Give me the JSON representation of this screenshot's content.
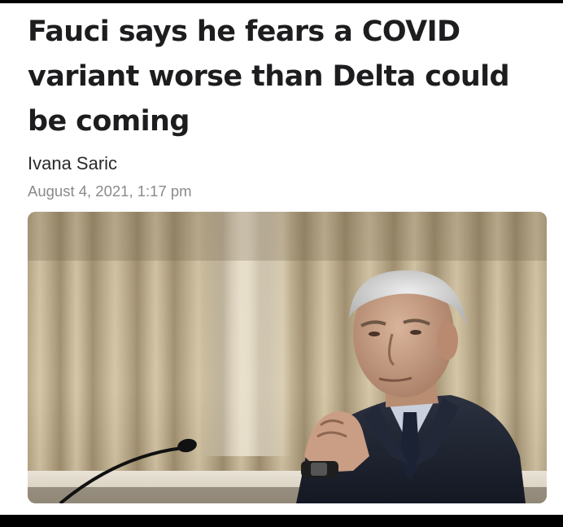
{
  "article": {
    "headline": "Fauci says he fears a COVID variant worse than Delta could be coming",
    "author": "Ivana Saric",
    "timestamp": "August 4, 2021, 1:17 pm"
  },
  "photo": {
    "subject": "man-in-suit-at-microphone-icon"
  },
  "colors": {
    "background": "#ffffff",
    "frame": "#000000",
    "headline": "#1d1d1f",
    "author": "#2a2a2a",
    "timestamp": "#8a8a8a"
  }
}
